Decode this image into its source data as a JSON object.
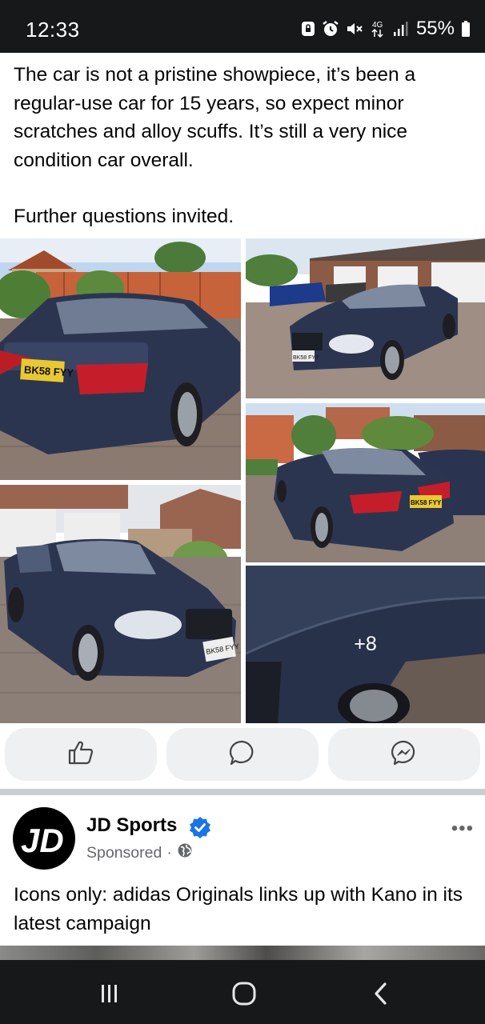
{
  "status_bar": {
    "time": "12:33",
    "network": "4G",
    "battery": "55%",
    "icons": [
      "screen-lock-icon",
      "alarm-icon",
      "mute-icon",
      "data-arrows-icon",
      "signal-icon",
      "battery-icon"
    ]
  },
  "post": {
    "paragraphs": [
      "The car is not a pristine showpiece, it’s been a regular-use car for 15 years, so expect minor scratches and alloy scuffs. It’s still a very nice condition car overall.",
      "Further questions invited."
    ],
    "photos": {
      "more_count": "+8",
      "plates": [
        "BK58 FYY",
        "BK58 FYY",
        "BK58 FYY",
        "BK58 FYY"
      ]
    },
    "actions": [
      {
        "name": "like",
        "icon": "thumbs-up-icon"
      },
      {
        "name": "comment",
        "icon": "comment-bubble-icon"
      },
      {
        "name": "send",
        "icon": "messenger-icon"
      }
    ]
  },
  "sponsored_post": {
    "logo_text": "JD",
    "page_name": "JD Sports",
    "sponsored_label": "Sponsored",
    "separator": "·",
    "audience_icon": "globe-icon",
    "more_icon": "•••",
    "text": "Icons only: adidas Originals links up with Kano in its latest campaign"
  },
  "nav_bar": {
    "buttons": [
      "recent-apps-icon",
      "home-icon",
      "back-icon"
    ]
  },
  "colors": {
    "status_bar_bg": "#16181a",
    "car_body": "#2c3550",
    "verified_blue": "#1b74e4",
    "button_bg": "#eef0f2"
  }
}
